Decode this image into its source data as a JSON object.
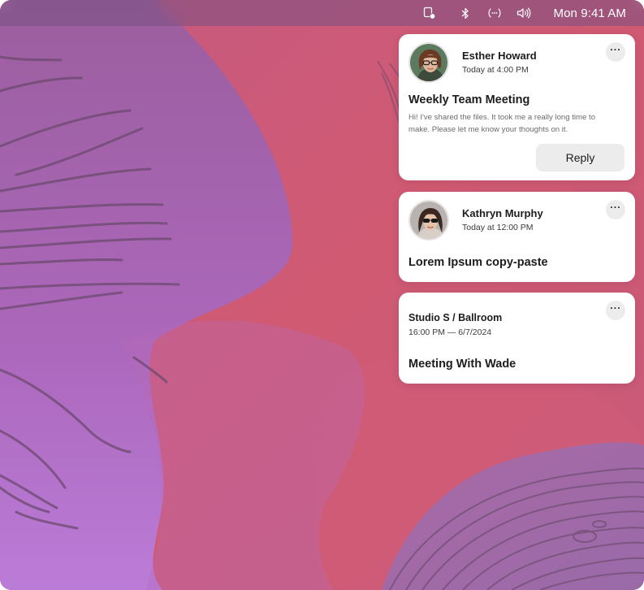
{
  "menubar": {
    "icons": [
      "screen-mirror-icon",
      "bluetooth-icon",
      "airdrop-icon",
      "volume-icon"
    ],
    "clock": "Mon 9:41 AM"
  },
  "notifications": [
    {
      "sender": "Esther Howard",
      "time": "Today at 4:00 PM",
      "title": "Weekly Team Meeting",
      "body": "Hi! I've shared the files. It took me a really long time to make. Please let me know your thoughts on it.",
      "action": "Reply",
      "more": "···"
    },
    {
      "sender": "Kathryn Murphy",
      "time": "Today at 12:00 PM",
      "title": "Lorem Ipsum copy-paste",
      "more": "···"
    },
    {
      "location": "Studio S / Ballroom",
      "time": "16:00 PM — 6/7/2024",
      "title": "Meeting With Wade",
      "more": "···"
    }
  ],
  "colors": {
    "wallpaper_pink": "#c95578",
    "wallpaper_purple": "#a66ac8",
    "card": "#ffffff",
    "button": "#ececec"
  }
}
